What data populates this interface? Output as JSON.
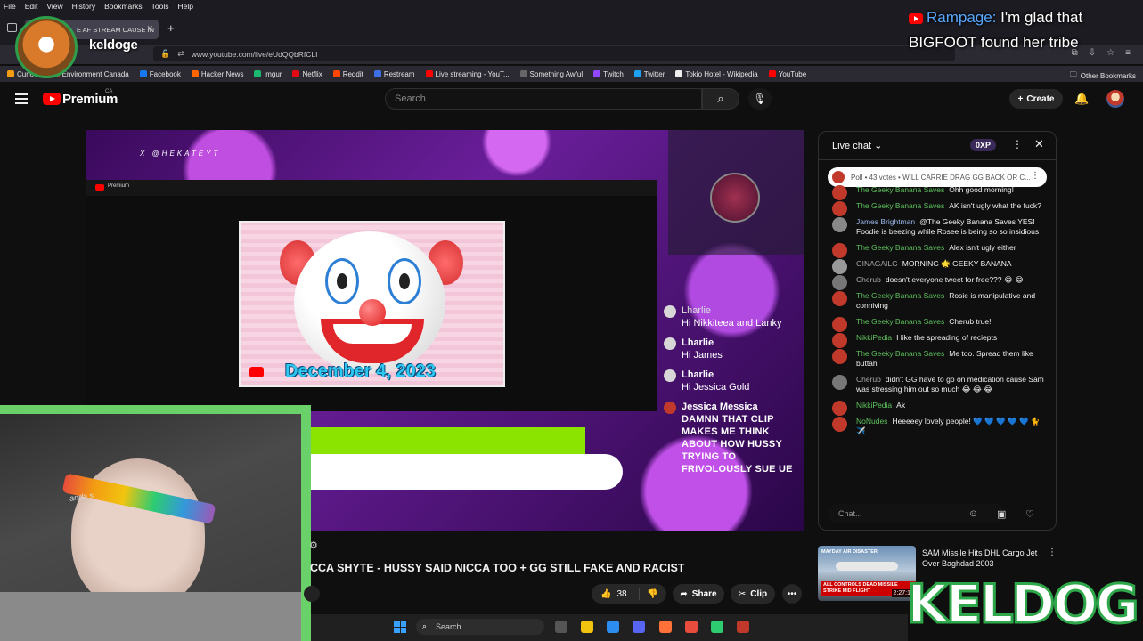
{
  "menubar": [
    "File",
    "Edit",
    "View",
    "History",
    "Bookmarks",
    "Tools",
    "Help"
  ],
  "tab": {
    "title": "E AF STREAM CAUSE IN"
  },
  "url": "www.youtube.com/live/eUdQQbRfCLI",
  "bookmarks": [
    {
      "label": "Curious",
      "color": "#f39c12"
    },
    {
      "label": "Environment Canada",
      "color": "#c0392b"
    },
    {
      "label": "Facebook",
      "color": "#1877f2"
    },
    {
      "label": "Hacker News",
      "color": "#ff6600"
    },
    {
      "label": "imgur",
      "color": "#1bb76e"
    },
    {
      "label": "Netflix",
      "color": "#e50914"
    },
    {
      "label": "Reddit",
      "color": "#ff4500"
    },
    {
      "label": "Restream",
      "color": "#3d6fe8"
    },
    {
      "label": "Live streaming - YouT...",
      "color": "#ff0000"
    },
    {
      "label": "Something Awful",
      "color": "#666666"
    },
    {
      "label": "Twitch",
      "color": "#9146ff"
    },
    {
      "label": "Twitter",
      "color": "#1da1f2"
    },
    {
      "label": "Tokio Hotel - Wikipedia",
      "color": "#eeeeee"
    },
    {
      "label": "YouTube",
      "color": "#ff0000"
    }
  ],
  "other_bookmarks": "Other Bookmarks",
  "yt": {
    "brand": "Premium",
    "region": "CA",
    "search_placeholder": "Search",
    "create_label": "Create"
  },
  "video": {
    "watermark": "X @HEKATEYT",
    "inner_brand": "Premium",
    "date_text": "December 4, 2023",
    "title": "CCA SHYTE - HUSSY SAID NICCA TOO + GG STILL FAKE AND RACIST",
    "likes": "38",
    "share_label": "Share",
    "clip_label": "Clip",
    "overlay_chat": [
      {
        "name": "Lharlie",
        "text": "Hi Nikkiteea and Lanky"
      },
      {
        "name": "Lharlie",
        "text": "Hi James"
      },
      {
        "name": "Lharlie",
        "text": "Hi Jessica Gold"
      },
      {
        "name": "Jessica Messica",
        "text": "DAMNN THAT CLIP MAKES ME THINK ABOUT HOW HUSSY TRYING TO FRIVOLOUSLY SUE UE"
      }
    ],
    "webcam_tag": "anda s"
  },
  "chat": {
    "title": "Live chat",
    "xp": "0XP",
    "poll": "Poll • 43 votes • WILL CARRIE DRAG GG BACK OR C...",
    "input_placeholder": "Chat...",
    "messages": [
      {
        "name": "The Geeky Banana Saves",
        "text": "Ohh good morning!",
        "nameColor": "green",
        "avColor": "#c0392b"
      },
      {
        "name": "The Geeky Banana Saves",
        "text": "AK isn't ugly what the fuck?",
        "nameColor": "green",
        "avColor": "#c0392b"
      },
      {
        "name": "James Brightman",
        "text": "@The Geeky Banana Saves YES! Foodie is beezing while Rosee is being so so insidious",
        "nameColor": "blue",
        "avColor": "#888888"
      },
      {
        "name": "The Geeky Banana Saves",
        "text": "Alex isn't ugly either",
        "nameColor": "green",
        "avColor": "#c0392b"
      },
      {
        "name": "GINAGAILG",
        "text": "MORNING 🌟 GEEKY BANANA",
        "nameColor": "grey",
        "avColor": "#999999"
      },
      {
        "name": "Cherub",
        "text": "doesn't everyone tweet for free??? 😂 😂",
        "nameColor": "grey",
        "avColor": "#777777"
      },
      {
        "name": "The Geeky Banana Saves",
        "text": "Rosie is manipulative and conniving",
        "nameColor": "green",
        "avColor": "#c0392b"
      },
      {
        "name": "The Geeky Banana Saves",
        "text": "Cherub true!",
        "nameColor": "green",
        "avColor": "#c0392b"
      },
      {
        "name": "NikkiPedia",
        "text": "I like the spreading of reciepts",
        "nameColor": "green",
        "avColor": "#c0392b"
      },
      {
        "name": "The Geeky Banana Saves",
        "text": "Me too. Spread them like buttah",
        "nameColor": "green",
        "avColor": "#c0392b"
      },
      {
        "name": "Cherub",
        "text": "didn't GG have to go on medication cause Sam was stressing him out so much 😂 😂 😂",
        "nameColor": "grey",
        "avColor": "#777777"
      },
      {
        "name": "NikkiPedia",
        "text": "Ak",
        "nameColor": "green",
        "avColor": "#c0392b"
      },
      {
        "name": "NoNudes",
        "text": "Heeeeey lovely people! 💙 💙 💙 💙 💙 🐈 ✈️",
        "nameColor": "green",
        "avColor": "#c0392b"
      }
    ]
  },
  "recommended": {
    "title": "SAM Missile Hits DHL Cargo Jet Over Baghdad 2003",
    "brand": "MAYDAY AIR DISASTER",
    "thumb_label": "ALL CONTROLS DEAD MISSILE STRIKE MID FLIGHT",
    "duration": "2:27:1"
  },
  "taskbar": {
    "search": "Search"
  },
  "stream": {
    "name": "keldoge",
    "alert_who": "Rampage:",
    "alert_text": " I'm glad that BIGFOOT found her tribe",
    "logo_text": "KELDOGE"
  }
}
